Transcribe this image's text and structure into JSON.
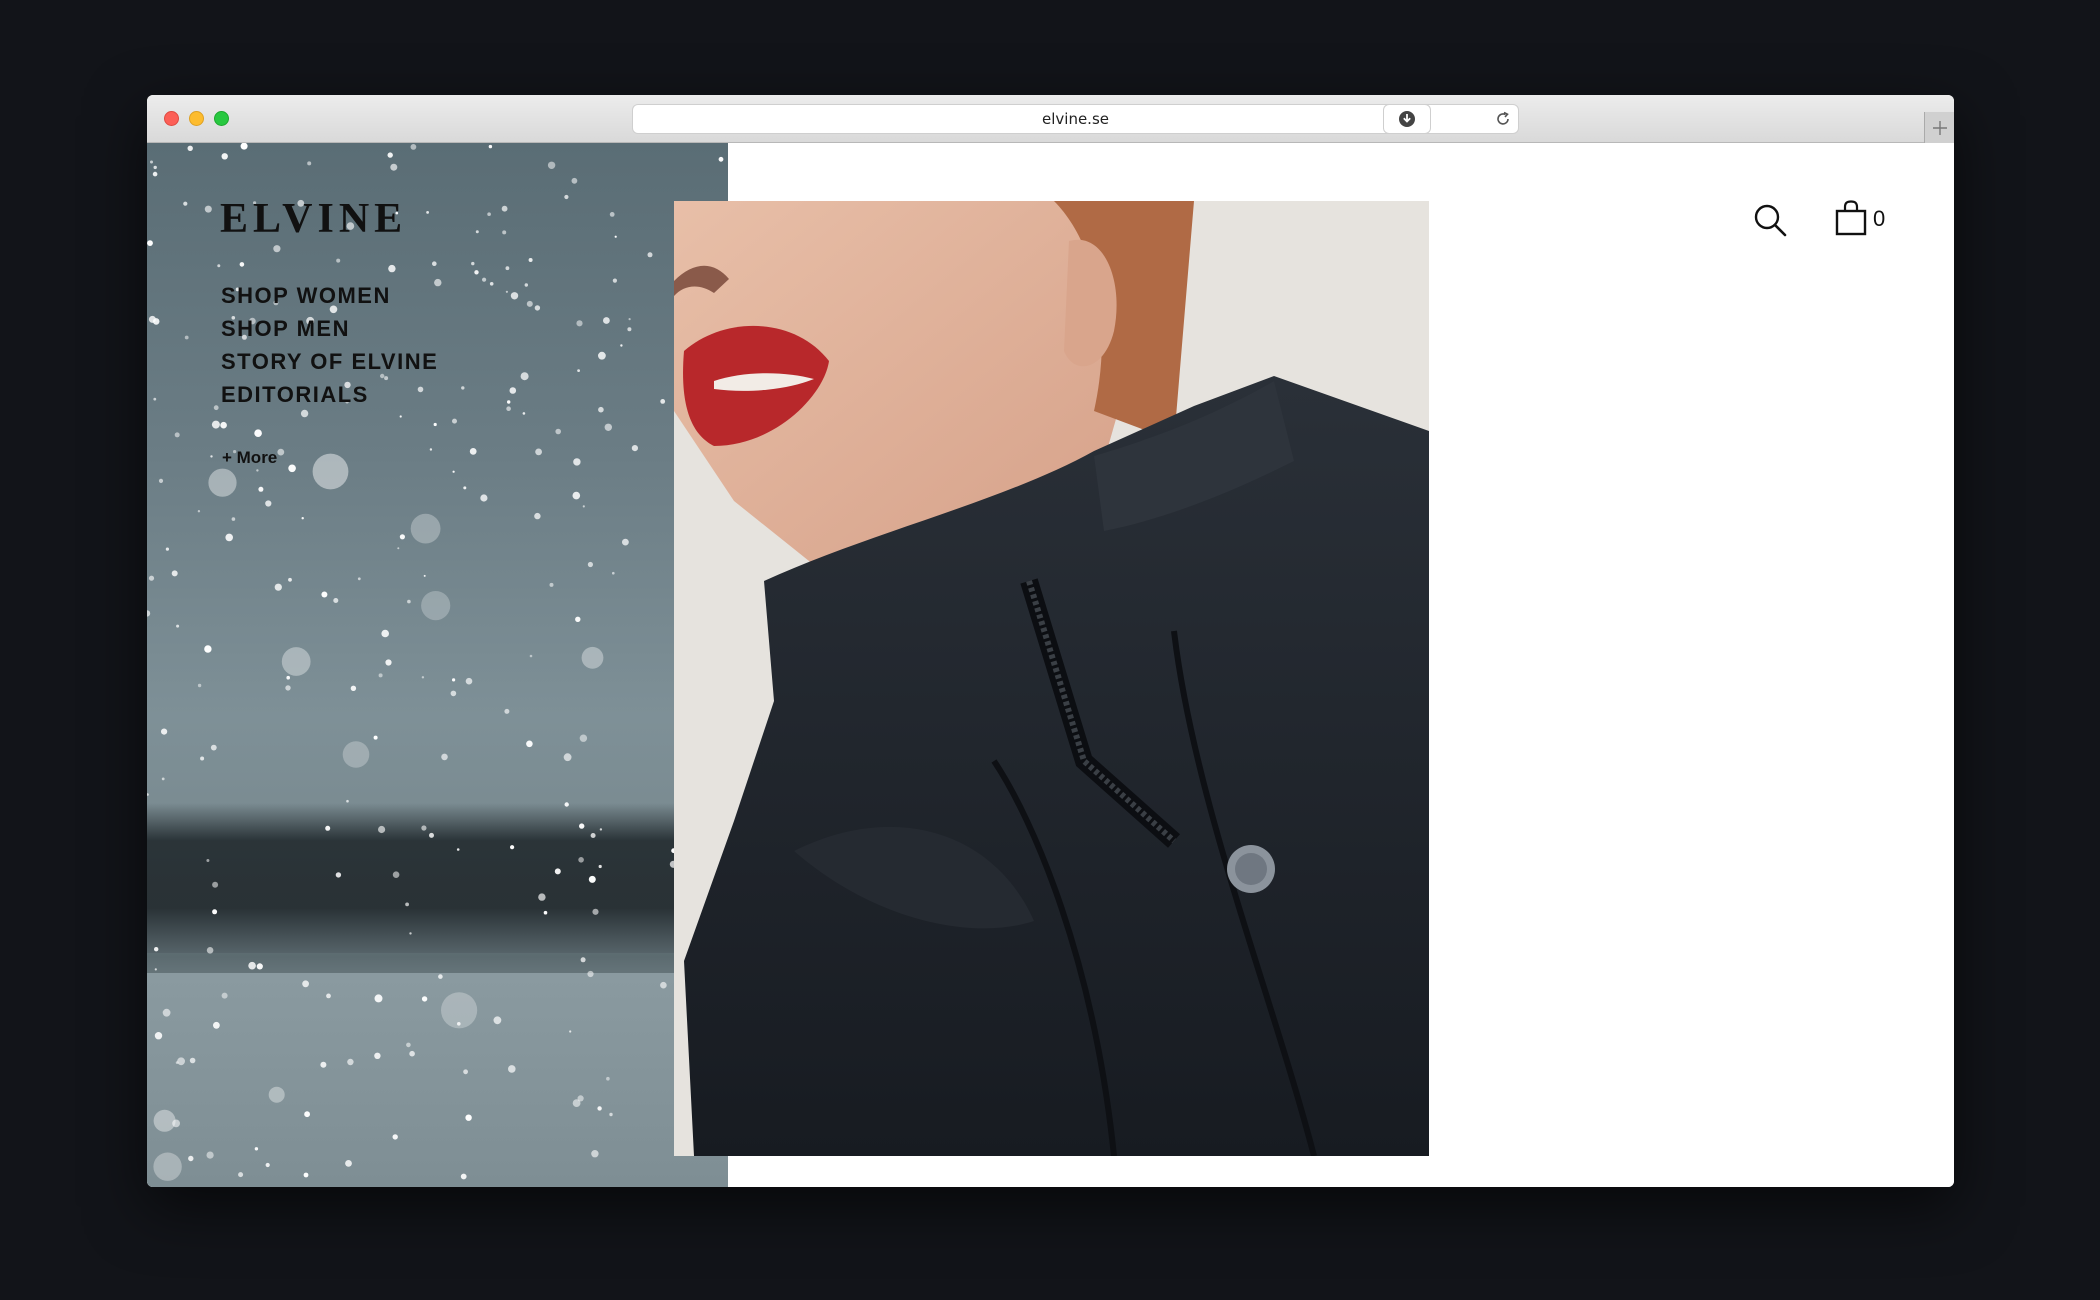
{
  "browser": {
    "url": "elvine.se"
  },
  "site": {
    "logo": "ELVINE",
    "nav": [
      {
        "label": "SHOP WOMEN"
      },
      {
        "label": "SHOP MEN"
      },
      {
        "label": "STORY OF ELVINE"
      },
      {
        "label": "EDITORIALS"
      }
    ],
    "more_label": "+ More",
    "cart_count": "0"
  },
  "icons": {
    "search": "search-icon",
    "cart": "shopping-bag-icon",
    "reload": "reload-icon",
    "download": "download-icon",
    "new_tab": "plus-icon"
  },
  "colors": {
    "page_background": "#121419",
    "text": "#111111",
    "lips": "#b8282b",
    "jacket": "#1e232a"
  }
}
